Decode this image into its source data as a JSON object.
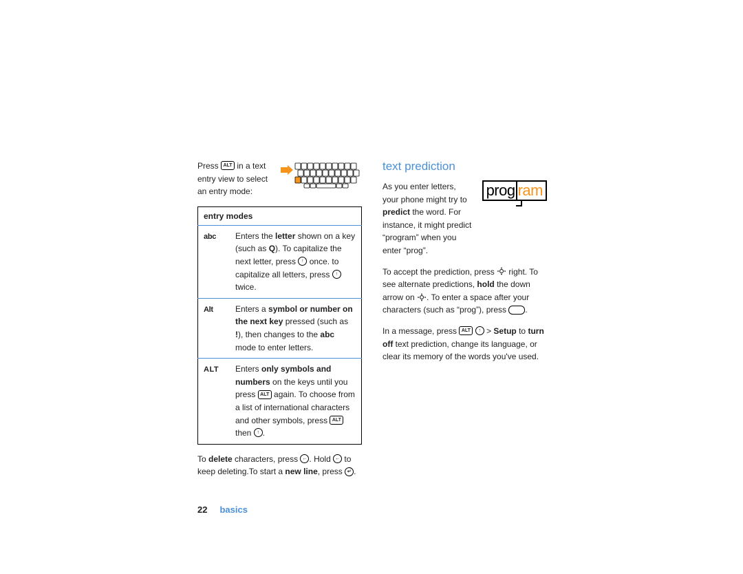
{
  "left": {
    "intro_pre": "Press ",
    "intro_after_alt": " in a text entry view to select an entry mode:",
    "table_header": "entry modes",
    "modes": [
      {
        "label": "abc",
        "desc_parts": {
          "a": "Enters the ",
          "b_letter": "letter",
          "c": " shown on a key (such as ",
          "d_q": "Q",
          "e": "). To capitalize the next letter, press ",
          "f": " once. to capitalize all letters, press ",
          "g": " twice."
        }
      },
      {
        "label": "Alt",
        "desc_parts": {
          "a": "Enters a ",
          "b_bold": "symbol or number on the next key",
          "c": " pressed (such as ",
          "d_ex": "!",
          "e": "), then changes to the ",
          "f_abc": "abc",
          "g": " mode to enter letters."
        }
      },
      {
        "label": "ALT",
        "desc_parts": {
          "a": "Enters ",
          "b_bold": "only symbols and numbers",
          "c": " on the keys until you press ",
          "d": " again. To choose from a list of international characters and other symbols, press ",
          "e": " then ",
          "f": "."
        }
      }
    ],
    "below": {
      "a": "To ",
      "b_del": "delete",
      "c": " characters, press ",
      "d": ". Hold ",
      "e": " to keep deleting.To start a ",
      "f_nl": "new line",
      "g": ", press ",
      "h": "."
    }
  },
  "right": {
    "heading": "text prediction",
    "p1": {
      "a": "As you enter letters, your phone might try to ",
      "b_predict": "predict",
      "c": " the word. For instance, it might predict “program” when you enter “prog”."
    },
    "progword": {
      "typed": "prog",
      "pred": "ram"
    },
    "p2": {
      "a": "To accept the prediction, press ",
      "b": " right. To see alternate predictions, ",
      "c_hold": "hold",
      "d": " the down arrow on ",
      "e": ". To enter a space after your characters (such as “prog”), press ",
      "f": "."
    },
    "p3": {
      "a": "In a message, press ",
      "b": " ",
      "c": " > ",
      "d_setup": "Setup",
      "e": " to ",
      "f_turn": "turn off",
      "g": " text prediction, change its language, or clear its memory of the words you've used."
    }
  },
  "footer": {
    "page": "22",
    "section": "basics"
  },
  "key_glyphs": {
    "alt": "ALT",
    "shift_up": "↑",
    "back": "←",
    "enter": "↵",
    "space": " "
  }
}
